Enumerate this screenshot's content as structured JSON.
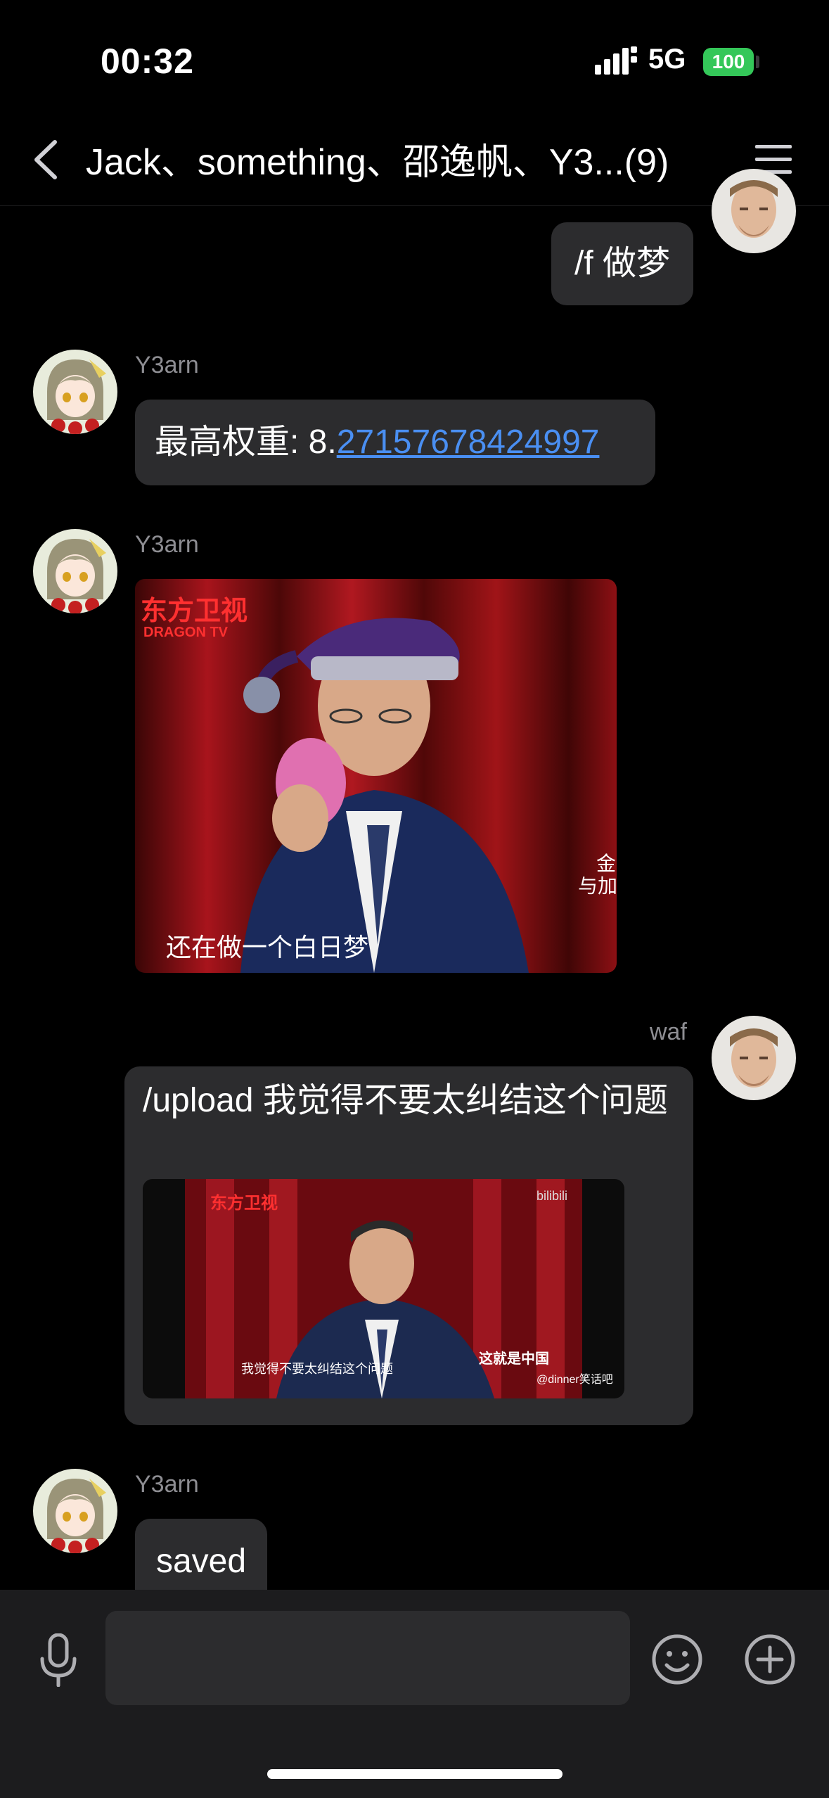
{
  "status_bar": {
    "time": "00:32",
    "network": "5G",
    "battery": "100"
  },
  "header": {
    "title": "Jack、something、邵逸帆、Y3...(9)"
  },
  "messages": [
    {
      "sender": "",
      "text": "/f 做梦"
    },
    {
      "sender": "Y3arn",
      "text_prefix": "最高权重: 8.",
      "text_link": "27157678424997"
    },
    {
      "sender": "Y3arn",
      "image": {
        "logo": "东方卫视",
        "logo_sub": "DRAGON TV",
        "caption": "还在做一个白日梦",
        "side_text_1": "金",
        "side_text_2": "与加"
      }
    },
    {
      "sender": "waf",
      "text": "/upload 我觉得不要太纠结这个问题",
      "video": {
        "logo": "东方卫视",
        "caption": "我觉得不要太纠结这个问题",
        "show_name": "这就是中国",
        "watermark": "@dinner笑话吧",
        "corner_mark": "bilibili"
      }
    },
    {
      "sender": "Y3arn",
      "text": "saved"
    }
  ],
  "colors": {
    "accent_link": "#4a8ff2",
    "battery": "#34c759",
    "bubble": "#2c2c2e"
  }
}
